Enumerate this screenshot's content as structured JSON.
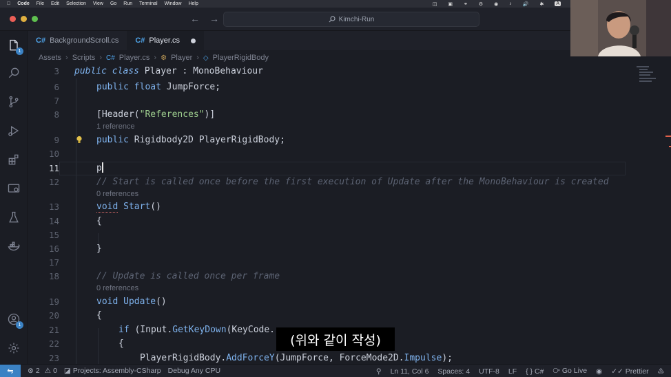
{
  "menubar": {
    "app": "Code",
    "items": [
      "File",
      "Edit",
      "Selection",
      "View",
      "Go",
      "Run",
      "Terminal",
      "Window",
      "Help"
    ],
    "status_a": "A"
  },
  "window": {
    "search_text": "Kimchi-Run"
  },
  "activity_bar": {
    "explorer_badge": "1",
    "accounts_badge": "1"
  },
  "tabs": [
    {
      "label": "BackgroundScroll.cs",
      "icon": "C#"
    },
    {
      "label": "Player.cs",
      "icon": "C#",
      "modified": true
    }
  ],
  "breadcrumb": [
    "Assets",
    "Scripts",
    "Player.cs",
    "Player",
    "PlayerRigidBody"
  ],
  "editor": {
    "lines": {
      "l3": "3",
      "l6": "6",
      "l7": "7",
      "l8": "8",
      "l9": "9",
      "l10": "10",
      "l11": "11",
      "l12": "12",
      "l13": "13",
      "l14": "14",
      "l15": "15",
      "l16": "16",
      "l17": "17",
      "l18": "18",
      "l19": "19",
      "l20": "20",
      "l21": "21",
      "l22": "22",
      "l23": "23"
    },
    "code": {
      "c3_kw": "public class",
      "c3_rest": " Player : MonoBehaviour",
      "c6_kw": "public float",
      "c6_rest": " JumpForce;",
      "c8_a": "[Header(",
      "c8_str": "\"References\"",
      "c8_b": ")]",
      "lens9": "1 reference",
      "c9_kw": "public",
      "c9_rest": " Rigidbody2D PlayerRigidBody;",
      "c11": "p",
      "c12": "// Start is called once before the first execution of Update after the MonoBehaviour is created",
      "lens13": "0 references",
      "c13_kw": "void",
      "c13_fn": "Start",
      "c13_rest": "()",
      "c14": "{",
      "c16": "}",
      "c18": "// Update is called once per frame",
      "lens19": "0 references",
      "c19_kw": "void",
      "c19_fn": "Update",
      "c19_rest": "()",
      "c20": "{",
      "c21_kw": "if",
      "c21_a": " (Input.",
      "c21_fn": "GetKeyDown",
      "c21_b": "(KeyCode.",
      "c22": "{",
      "c23_a": "PlayerRigidBody.",
      "c23_fn": "AddForceY",
      "c23_b": "(JumpForce, ForceMode2D.",
      "c23_c": "Impulse",
      "c23_d": ");"
    }
  },
  "subtitle": "(위와 같이 작성)",
  "statusbar": {
    "errors": "2",
    "warnings": "0",
    "projects": "Projects: Assembly-CSharp",
    "debug": "Debug Any CPU",
    "position": "Ln 11, Col 6",
    "spaces": "Spaces: 4",
    "encoding": "UTF-8",
    "eol": "LF",
    "language": "C#",
    "golive": "Go Live",
    "prettier": "Prettier"
  }
}
